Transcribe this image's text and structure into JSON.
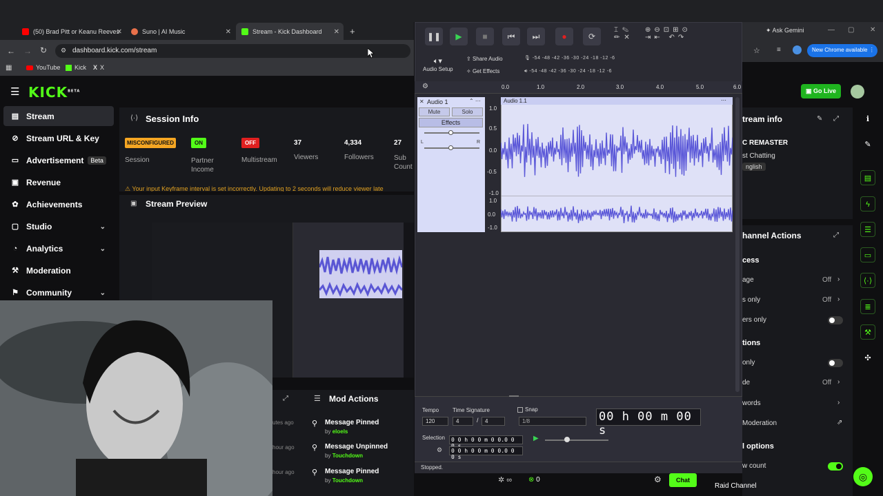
{
  "browser": {
    "tabs": [
      {
        "label": "(50) Brad Pitt or Keanu Reeves",
        "color": "#ff0000"
      },
      {
        "label": "Suno | AI Music",
        "color": "#e8704a"
      },
      {
        "label": "Stream - Kick Dashboard",
        "color": "#53fc18"
      }
    ],
    "url": "dashboard.kick.com/stream",
    "bookmarks": [
      "YouTube",
      "Kick",
      "X"
    ],
    "ask_gemini": "Ask Gemini",
    "new_chrome": "New Chrome available"
  },
  "kick": {
    "logo": "KICK",
    "logo_badge": "BETA",
    "nav": [
      {
        "label": "Stream",
        "icon": "stream-icon"
      },
      {
        "label": "Stream URL & Key",
        "icon": "link-icon"
      },
      {
        "label": "Advertisement",
        "icon": "ad-icon",
        "badge": "Beta"
      },
      {
        "label": "Revenue",
        "icon": "revenue-icon"
      },
      {
        "label": "Achievements",
        "icon": "achievements-icon"
      },
      {
        "label": "Studio",
        "icon": "studio-icon"
      },
      {
        "label": "Analytics",
        "icon": "analytics-icon"
      },
      {
        "label": "Moderation",
        "icon": "moderation-icon"
      },
      {
        "label": "Community",
        "icon": "community-icon"
      }
    ],
    "session": {
      "title": "Session Info",
      "status_badge": "MISCONFIGURED",
      "status_label": "Session",
      "partner_badge": "ON",
      "partner_label": "Partner\nIncome",
      "multistream_badge": "OFF",
      "multistream_label": "Multistream",
      "viewers": "37",
      "viewers_label": "Viewers",
      "followers": "4,334",
      "followers_label": "Followers",
      "subs": "27",
      "subs_label": "Sub Count",
      "warning": "Your input Keyframe interval is set incorrectly. Updating to 2 seconds will reduce viewer late"
    },
    "preview_title": "Stream Preview",
    "mod_actions": {
      "title": "Mod Actions",
      "items": [
        {
          "time": "utes ago",
          "action": "Message Pinned",
          "by": "by",
          "user": "eloels"
        },
        {
          "time": "hour ago",
          "action": "Message Unpinned",
          "by": "by",
          "user": "Touchdown"
        },
        {
          "time": "hour ago",
          "action": "Message Pinned",
          "by": "by",
          "user": "Touchdown"
        }
      ]
    },
    "right": {
      "go_live": "Go Live",
      "stream_info": "tream info",
      "remaster": "C REMASTER",
      "category": "st Chatting",
      "language": "nglish",
      "channel_actions": "hannel Actions",
      "access": "cess",
      "rows": [
        {
          "label": "age",
          "value": "Off"
        },
        {
          "label": "s only",
          "value": "Off"
        },
        {
          "label": "ers only",
          "value": ""
        }
      ],
      "options": "tions",
      "rows2": [
        {
          "label": "only",
          "value": ""
        },
        {
          "label": "de",
          "value": "Off"
        },
        {
          "label": "words",
          "value": ""
        },
        {
          "label": "Moderation",
          "value": ""
        }
      ],
      "l_options": "l options",
      "count_label": "w count",
      "raid": "Raid Channel",
      "chat_button": "Chat",
      "chat_count": "0"
    }
  },
  "audacity": {
    "setup": "Audio Setup",
    "share": "Share Audio",
    "effects_top": "Get Effects",
    "meter_scale": "-54 -48 -42 -36 -30 -24 -18 -12 -6",
    "ruler": [
      "0.0",
      "1.0",
      "2.0",
      "3.0",
      "4.0",
      "5.0",
      "6.0"
    ],
    "track_name": "Audio 1",
    "clip_name": "Audio 1.1",
    "mute": "Mute",
    "solo": "Solo",
    "effects": "Effects",
    "pan_l": "L",
    "pan_r": "R",
    "scale_top": [
      "1.0",
      "0.5",
      "0.0",
      "-0.5",
      "-1.0"
    ],
    "scale_bot": [
      "1.0",
      "0.0",
      "-1.0"
    ],
    "tempo_label": "Tempo",
    "tempo": "120",
    "timesig_label": "Time Signature",
    "timesig_num": "4",
    "timesig_den": "4",
    "snap": "Snap",
    "snap_value": "1/8",
    "big_time": "00 h 00 m 00 s",
    "selection": "Selection",
    "sel_start": "0 0 h 0 0 m 0 0.0 0 0 s",
    "sel_end": "0 0 h 0 0 m 0 0.0 0 0 s",
    "status": "Stopped."
  }
}
